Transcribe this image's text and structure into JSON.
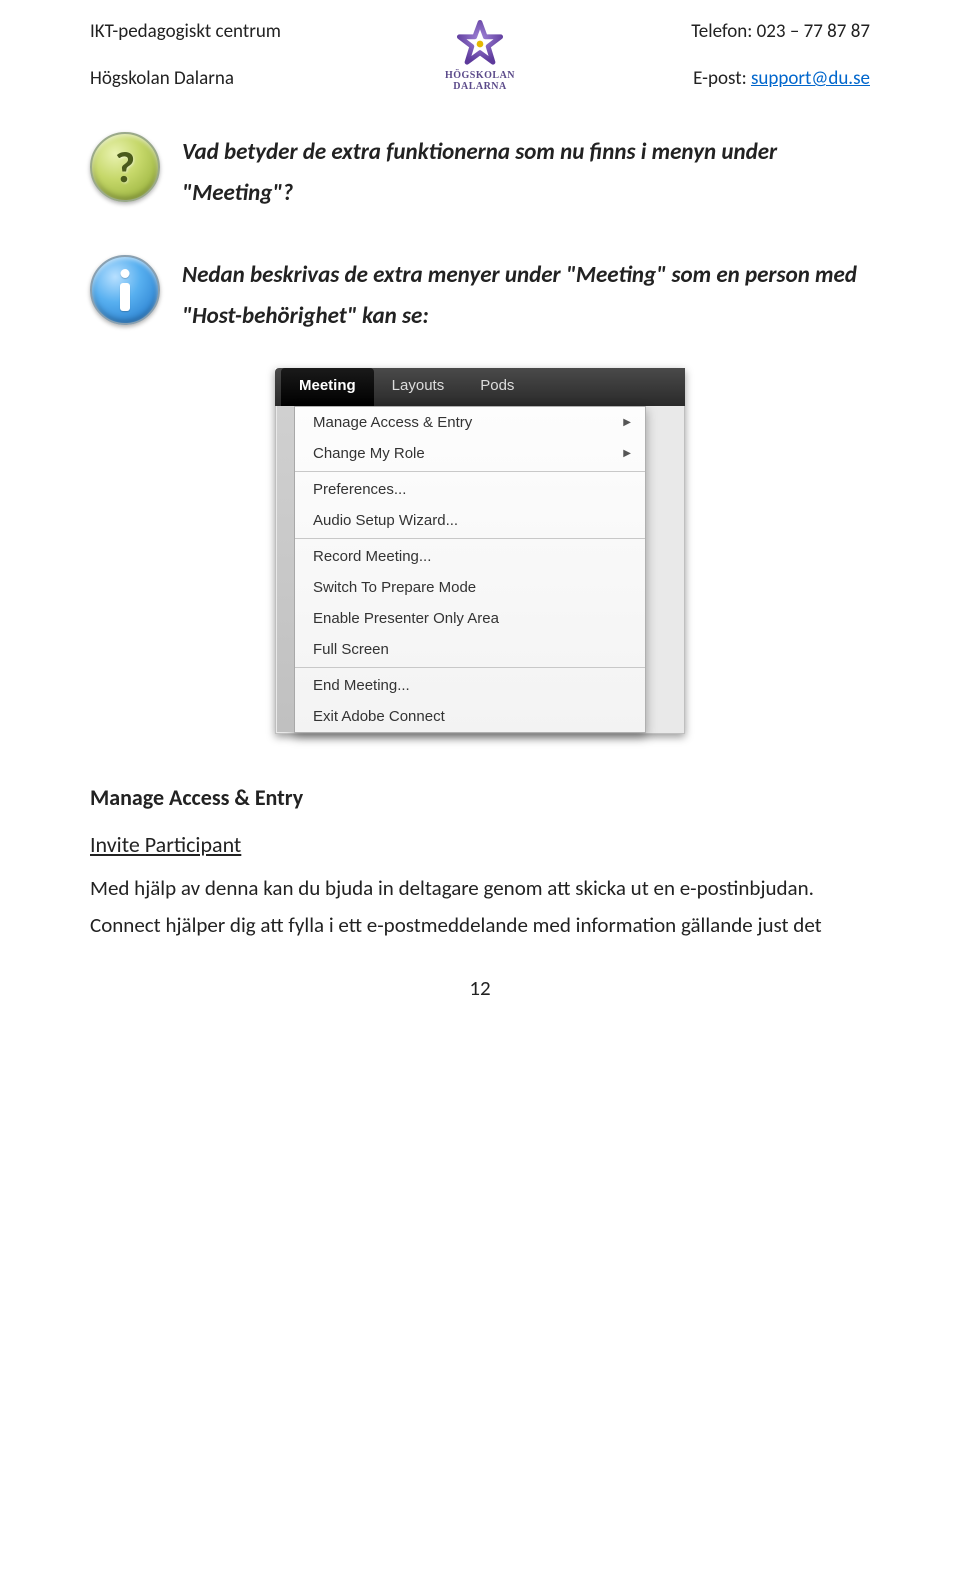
{
  "header": {
    "left_line1": "IKT-pedagogiskt centrum",
    "left_line2": "Högskolan Dalarna",
    "right_phone_label": "Telefon: ",
    "right_phone": "023 – 77 87 87",
    "right_email_label": "E-post: ",
    "right_email_link": "support@du.se",
    "logo_label": "HÖGSKOLAN\nDALARNA"
  },
  "question": {
    "text_prefix": "Vad betyder de extra funktionerna som nu finns i menyn under ",
    "quoted": "\"Meeting\"",
    "text_suffix": "?"
  },
  "answer": {
    "text_prefix": "Nedan beskrivas de extra menyer under ",
    "quoted1": "\"Meeting\"",
    "text_mid": " som en person med ",
    "quoted2": "\"Host-behörighet\"",
    "text_suffix": " kan se:"
  },
  "menu": {
    "tabs": [
      "Meeting",
      "Layouts",
      "Pods"
    ],
    "items_g1": [
      "Manage Access & Entry",
      "Change My Role"
    ],
    "items_g2": [
      "Preferences...",
      "Audio Setup Wizard..."
    ],
    "items_g3": [
      "Record Meeting...",
      "Switch To Prepare Mode",
      "Enable Presenter Only Area",
      "Full Screen"
    ],
    "items_g4": [
      "End Meeting...",
      "Exit Adobe Connect"
    ]
  },
  "content": {
    "h1": "Manage Access & Entry",
    "h2": "Invite Participant",
    "para": "Med hjälp av denna kan du bjuda in deltagare genom att skicka ut en e-postinbjudan. Connect hjälper dig att fylla i ett e-postmeddelande med information gällande just det"
  },
  "page_number": "12"
}
